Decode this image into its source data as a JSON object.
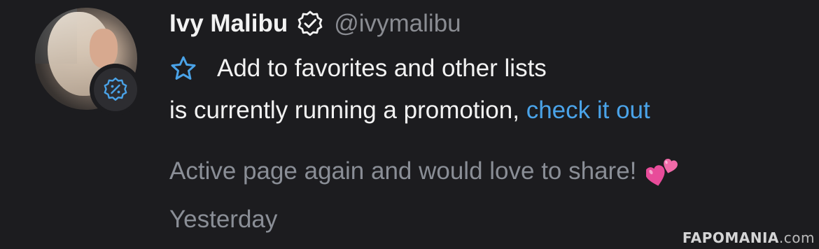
{
  "post": {
    "display_name": "Ivy Malibu",
    "handle": "@ivymalibu",
    "favorites_label": "Add to favorites and other lists",
    "promo_prefix": "is currently running a promotion, ",
    "promo_link": "check it out",
    "message": "Active page again and would love to share!",
    "timestamp": "Yesterday"
  },
  "icons": {
    "verified": "verified-badge-icon",
    "star": "star-outline-icon",
    "promo": "discount-badge-icon",
    "hearts": "two-hearts-emoji"
  },
  "colors": {
    "background": "#1c1c1f",
    "primary_text": "#f2f2f2",
    "muted_text": "#8a8e96",
    "link": "#4aa3e8",
    "hearts": "#e84c9a"
  },
  "watermark": {
    "brand_a": "FAPO",
    "brand_b": "MANIA",
    "suffix": ".com"
  }
}
